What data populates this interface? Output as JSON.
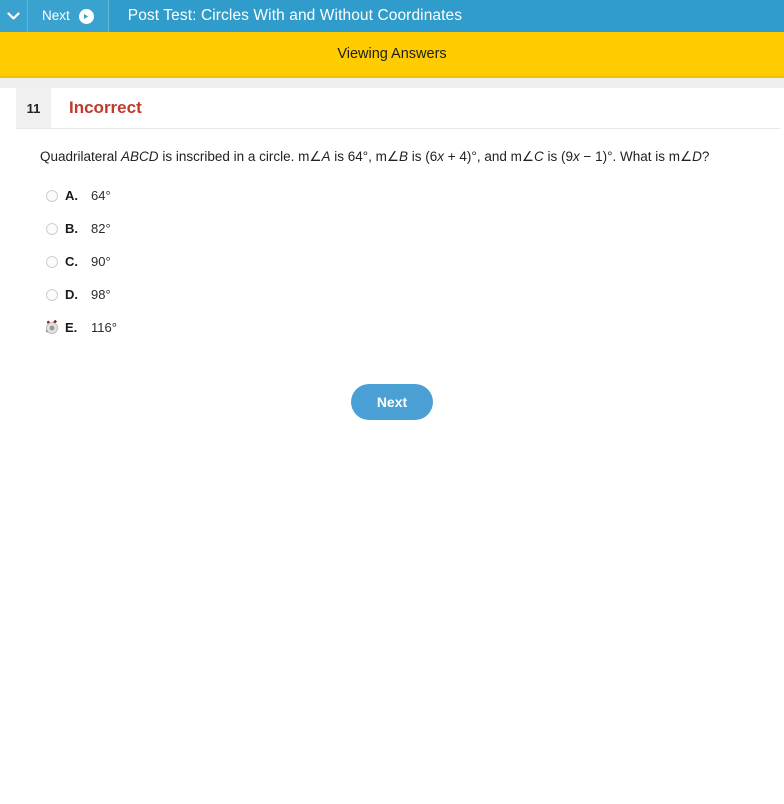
{
  "topbar": {
    "chevron_icon": "chevron-down-icon",
    "next_label": "Next",
    "next_arrow_icon": "arrow-right-circle-icon",
    "title": "Post Test: Circles With and Without Coordinates",
    "background_color": "#2f9ccb"
  },
  "statusbar": {
    "text": "Viewing Answers",
    "background_color": "#ffcc00"
  },
  "result": {
    "question_number": "11",
    "status": "Incorrect",
    "status_color": "#c0392b"
  },
  "question": {
    "text_part_1": "Quadrilateral ",
    "italic_1": "ABCD",
    "text_part_2": " is inscribed in a circle. m∠",
    "italic_2": "A",
    "text_part_3": " is 64°, m∠",
    "italic_3": "B",
    "text_part_4": " is (6",
    "italic_4": "x",
    "text_part_5": " + 4)°, and m∠",
    "italic_5": "C",
    "text_part_6": " is (9",
    "italic_6": "x",
    "text_part_7": " − 1)°. What is m∠",
    "italic_7": "D",
    "text_part_8": "?"
  },
  "options": [
    {
      "letter": "A.",
      "value": "64°",
      "selected": false,
      "marked_wrong": false
    },
    {
      "letter": "B.",
      "value": "82°",
      "selected": false,
      "marked_wrong": false
    },
    {
      "letter": "C.",
      "value": "90°",
      "selected": false,
      "marked_wrong": false
    },
    {
      "letter": "D.",
      "value": "98°",
      "selected": false,
      "marked_wrong": false
    },
    {
      "letter": "E.",
      "value": "116°",
      "selected": true,
      "marked_wrong": true,
      "mark_glyph": "✘"
    }
  ],
  "footer": {
    "next_button_label": "Next",
    "next_button_color": "#4a9fd5"
  }
}
